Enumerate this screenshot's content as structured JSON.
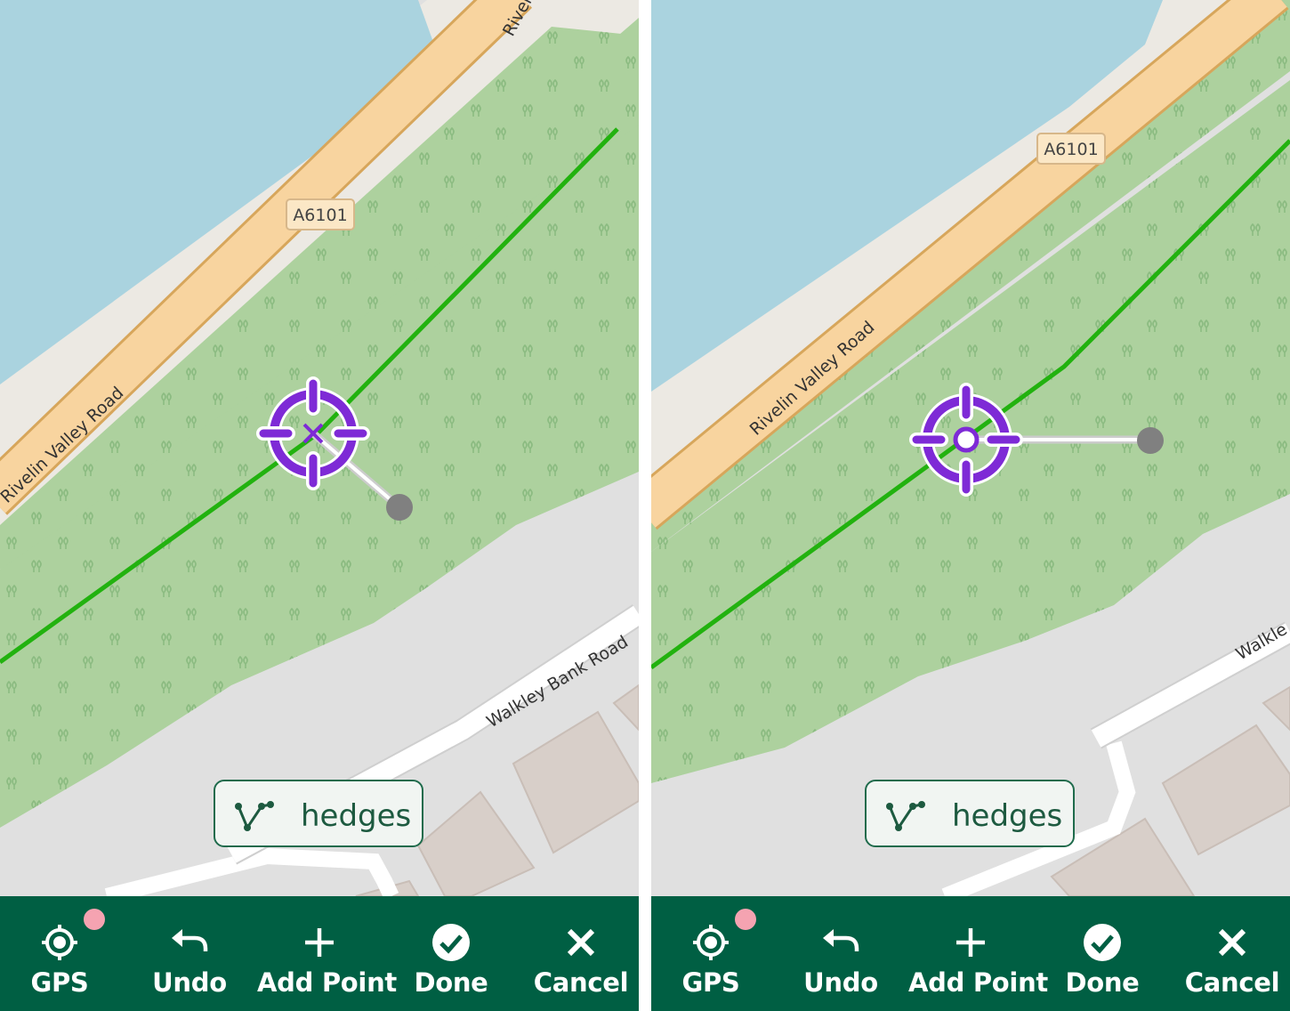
{
  "panels": [
    {
      "id": "left",
      "map": {
        "road_main_label": "Rivelin Valley Road",
        "road_main_label_cut": "River",
        "road_ref": "A6101",
        "road_secondary_label": "Walkley Bank Road"
      },
      "feature_chip": {
        "icon": "line-vertices-icon",
        "label": "hedges"
      },
      "toolbar": [
        {
          "key": "gps",
          "icon": "gps-crosshair-icon",
          "label": "GPS"
        },
        {
          "key": "undo",
          "icon": "undo-icon",
          "label": "Undo"
        },
        {
          "key": "add_point",
          "icon": "plus-icon",
          "label": "Add Point"
        },
        {
          "key": "done",
          "icon": "check-circle-icon",
          "label": "Done"
        },
        {
          "key": "cancel",
          "icon": "close-icon",
          "label": "Cancel"
        }
      ]
    },
    {
      "id": "right",
      "map": {
        "road_main_label": "Rivelin Valley Road",
        "road_ref": "A6101",
        "road_secondary_label": "Walkle"
      },
      "feature_chip": {
        "icon": "line-vertices-icon",
        "label": "hedges"
      },
      "toolbar": [
        {
          "key": "gps",
          "icon": "gps-crosshair-icon",
          "label": "GPS"
        },
        {
          "key": "undo",
          "icon": "undo-icon",
          "label": "Undo"
        },
        {
          "key": "add_point",
          "icon": "plus-icon",
          "label": "Add Point"
        },
        {
          "key": "done",
          "icon": "check-circle-icon",
          "label": "Done"
        },
        {
          "key": "cancel",
          "icon": "close-icon",
          "label": "Cancel"
        }
      ]
    }
  ],
  "colors": {
    "water": "#aad3df",
    "shore": "#ece9e3",
    "road_primary_fill": "#f8d49f",
    "road_primary_casing": "#d7a65b",
    "woodland": "#add19e",
    "tree_symbol": "#8bbb81",
    "residential": "#e0e0e0",
    "building": "#d8cfc9",
    "hedge_line": "#22b20f",
    "crosshair": "#7e2ad6",
    "vertex": "#808080",
    "toolbar_bg": "#005f43",
    "badge": "#f5a3b1"
  }
}
